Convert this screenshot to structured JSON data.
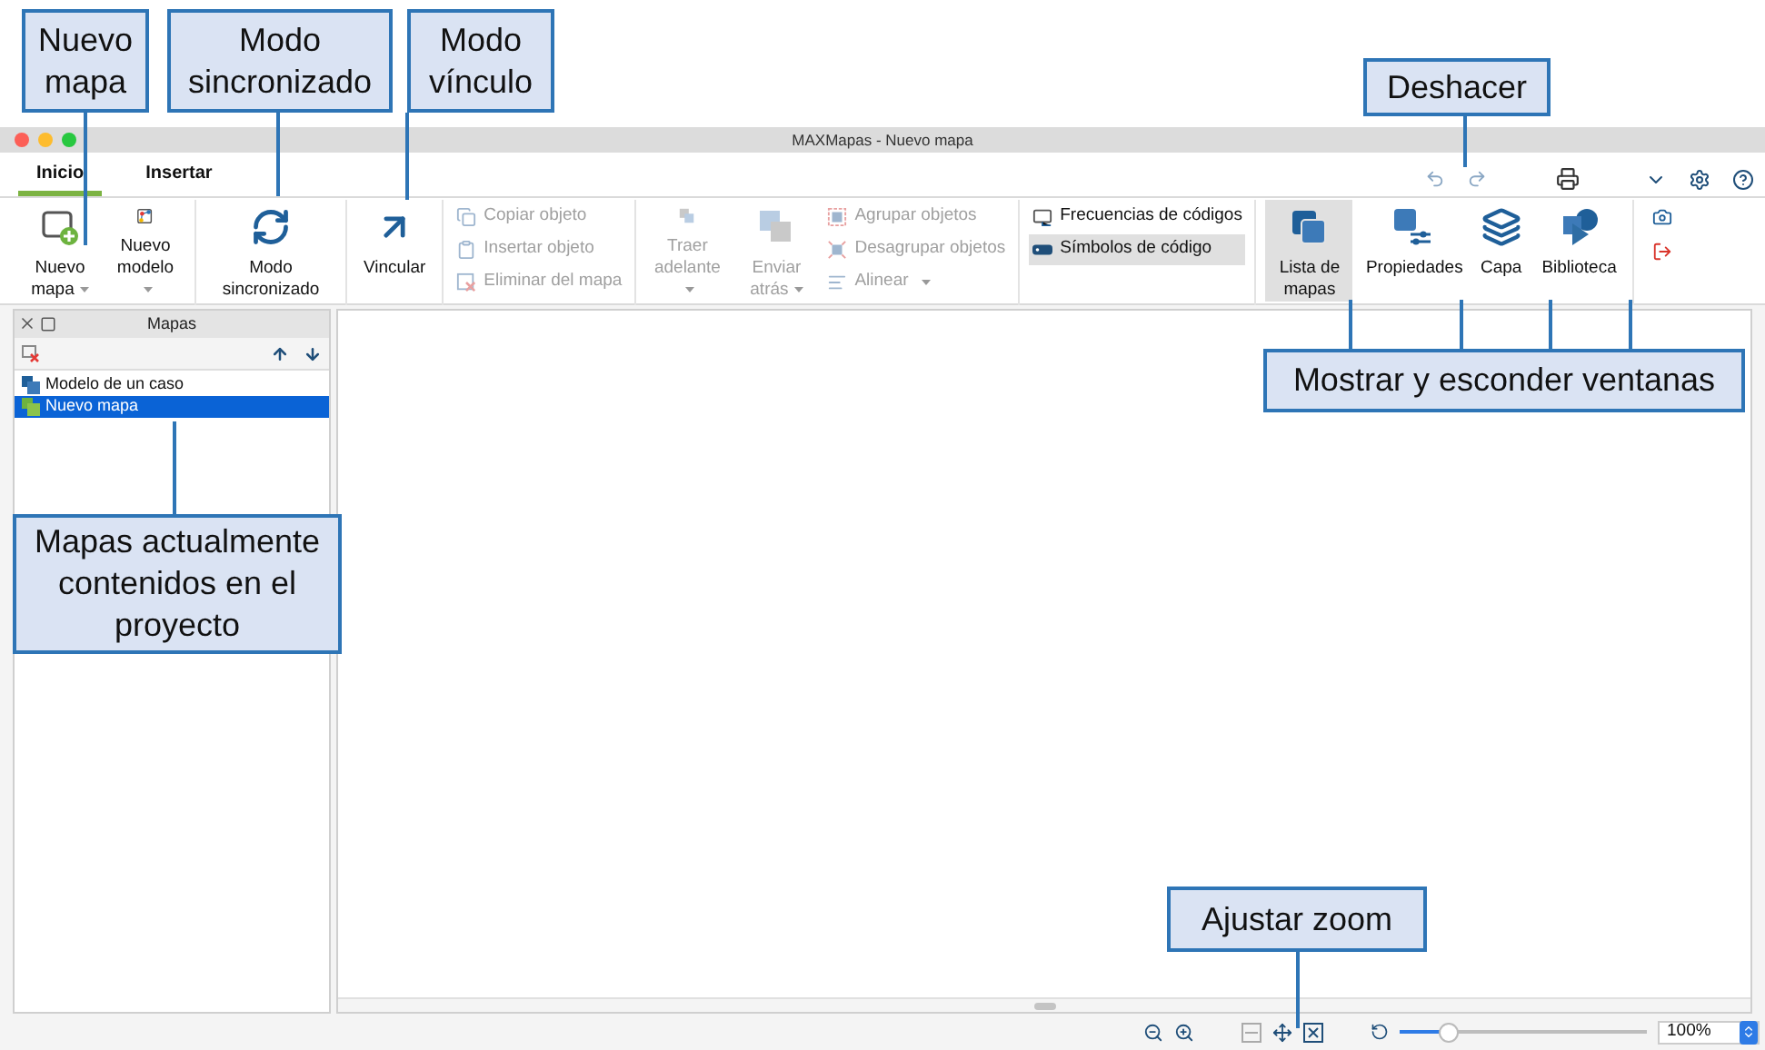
{
  "window": {
    "title": "MAXMapas - Nuevo mapa"
  },
  "tabs": [
    {
      "label": "Inicio",
      "selected": true
    },
    {
      "label": "Insertar",
      "selected": false
    }
  ],
  "ribbon": {
    "groups": [
      {
        "items": [
          {
            "kind": "large",
            "label": "Nuevo mapa",
            "menu": true,
            "disabled": false,
            "selected": false
          },
          {
            "kind": "large",
            "label": "Nuevo modelo",
            "menu": true,
            "disabled": false,
            "selected": false
          }
        ]
      },
      {
        "items": [
          {
            "kind": "large",
            "label": "Modo sincronizado",
            "menu": false,
            "disabled": false,
            "selected": false
          }
        ]
      },
      {
        "items": [
          {
            "kind": "large",
            "label": "Vincular",
            "menu": false,
            "disabled": false,
            "selected": false
          }
        ]
      },
      {
        "items": [
          {
            "kind": "small",
            "label": "Copiar objeto",
            "menu": false,
            "disabled": true,
            "selected": false
          },
          {
            "kind": "small",
            "label": "Insertar objeto",
            "menu": false,
            "disabled": true,
            "selected": false
          },
          {
            "kind": "small",
            "label": "Eliminar del mapa",
            "menu": false,
            "disabled": true,
            "selected": false
          }
        ]
      },
      {
        "items": [
          {
            "kind": "large",
            "label": "Traer adelante",
            "menu": true,
            "disabled": true,
            "selected": false
          },
          {
            "kind": "large",
            "label": "Enviar atrás",
            "menu": true,
            "disabled": true,
            "selected": false
          },
          {
            "kind": "small",
            "label": "Agrupar objetos",
            "menu": false,
            "disabled": true,
            "selected": false
          },
          {
            "kind": "small",
            "label": "Desagrupar objetos",
            "menu": false,
            "disabled": true,
            "selected": false
          },
          {
            "kind": "small",
            "label": "Alinear",
            "menu": true,
            "disabled": true,
            "selected": false
          }
        ]
      },
      {
        "items": [
          {
            "kind": "small",
            "label": "Frecuencias de códigos",
            "menu": false,
            "disabled": false,
            "selected": false
          },
          {
            "kind": "small",
            "label": "Símbolos de código",
            "menu": false,
            "disabled": false,
            "selected": true
          }
        ]
      },
      {
        "items": [
          {
            "kind": "large",
            "label": "Lista de mapas",
            "menu": false,
            "disabled": false,
            "selected": true
          },
          {
            "kind": "large",
            "label": "Propiedades",
            "menu": false,
            "disabled": false,
            "selected": false
          },
          {
            "kind": "large",
            "label": "Capa",
            "menu": false,
            "disabled": false,
            "selected": false
          },
          {
            "kind": "large",
            "label": "Biblioteca",
            "menu": false,
            "disabled": false,
            "selected": false
          }
        ]
      }
    ]
  },
  "maps_panel": {
    "title": "Mapas",
    "items": [
      {
        "label": "Modelo de un caso",
        "selected": false
      },
      {
        "label": "Nuevo mapa",
        "selected": true
      }
    ]
  },
  "status_bar": {
    "level": 0.2,
    "zoom": "100%"
  },
  "annotations": [
    {
      "text": "Nuevo mapa"
    },
    {
      "text": "Modo sincronizado"
    },
    {
      "text": "Modo vínculo"
    },
    {
      "text": "Deshacer"
    },
    {
      "text": "Mostrar y esconder ventanas"
    },
    {
      "text": "Mapas actualmente contenidos en el proyecto"
    },
    {
      "text": "Ajustar zoom"
    }
  ]
}
